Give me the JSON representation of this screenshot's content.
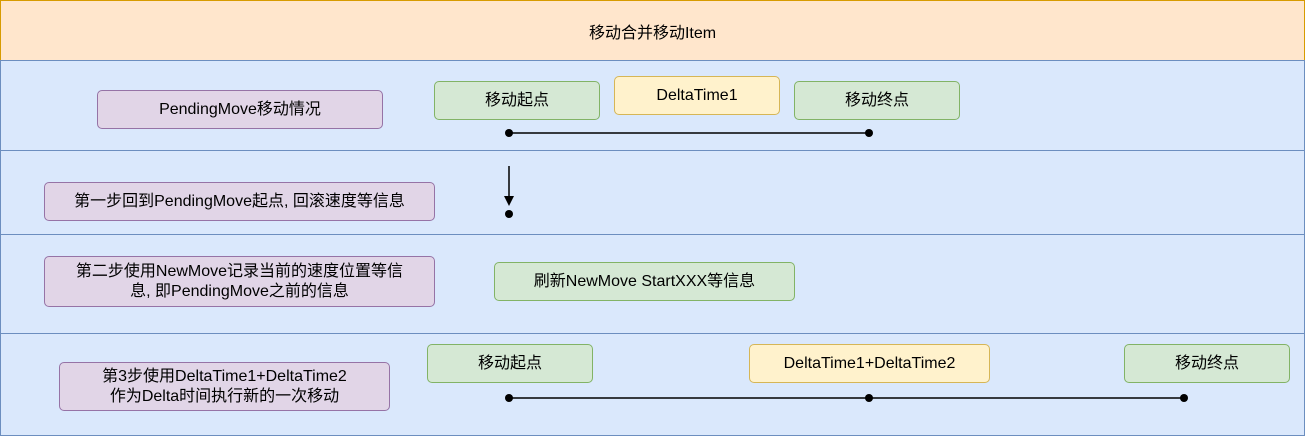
{
  "header": {
    "title": "移动合并移动Item"
  },
  "lane1": {
    "label": "PendingMove移动情况",
    "start": "移动起点",
    "delta": "DeltaTime1",
    "end": "移动终点"
  },
  "lane2": {
    "label": "第一步回到PendingMove起点, 回滚速度等信息"
  },
  "lane3": {
    "label_line1": "第二步使用NewMove记录当前的速度位置等信",
    "label_line2": "息, 即PendingMove之前的信息",
    "action": "刷新NewMove StartXXX等信息"
  },
  "lane4": {
    "label_line1": "第3步使用DeltaTime1+DeltaTime2",
    "label_line2": "作为Delta时间执行新的一次移动",
    "start": "移动起点",
    "delta": "DeltaTime1+DeltaTime2",
    "end": "移动终点"
  },
  "colors": {
    "header_fill": "#ffe6cc",
    "header_stroke": "#d79b00",
    "lane_fill": "#dae8fc",
    "lane_stroke": "#6c8ebf",
    "purple_fill": "#e1d5e7",
    "purple_stroke": "#9673a6",
    "green_fill": "#d5e8d4",
    "green_stroke": "#82b366",
    "yellow_fill": "#fff2cc",
    "yellow_stroke": "#d6b656"
  }
}
